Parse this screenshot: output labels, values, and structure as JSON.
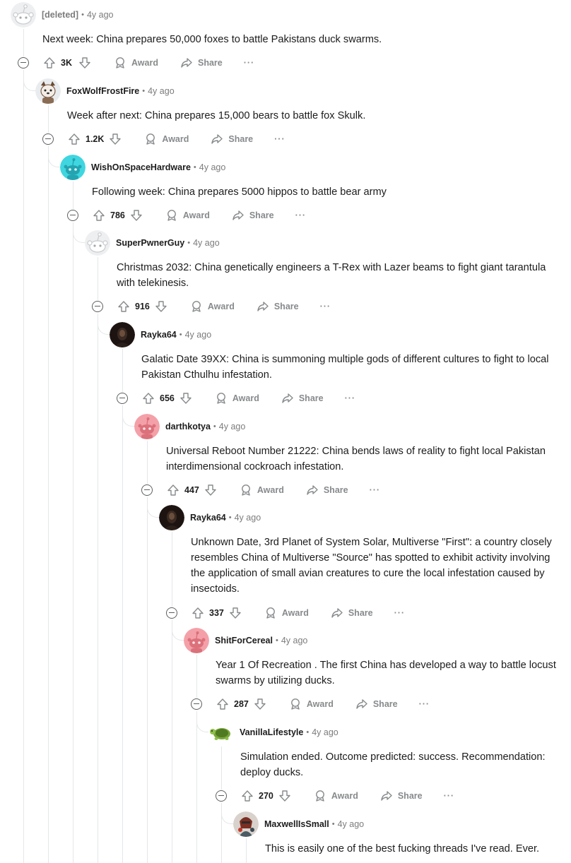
{
  "comments": [
    {
      "user": "[deleted]",
      "time": "4y ago",
      "lines": [
        "Next week: China prepares 50,000 foxes to battle Pakistans duck swarms."
      ],
      "votes": "3K",
      "avatar": "snoo-gray"
    },
    {
      "user": "FoxWolfFrostFire",
      "time": "4y ago",
      "lines": [
        "Week after next: China prepares 15,000 bears to battle fox Skulk."
      ],
      "votes": "1.2K",
      "avatar": "fox"
    },
    {
      "user": "WishOnSpaceHardware",
      "time": "4y ago",
      "lines": [
        "Following week: China prepares 5000 hippos to battle bear army"
      ],
      "votes": "786",
      "avatar": "snoo-teal"
    },
    {
      "user": "SuperPwnerGuy",
      "time": "4y ago",
      "lines": [
        "Christmas 2032: China genetically engineers a T-Rex with Lazer beams to fight giant tarantula",
        "with telekinesis."
      ],
      "votes": "916",
      "avatar": "snoo-gray"
    },
    {
      "user": "Rayka64",
      "time": "4y ago",
      "lines": [
        "Galatic Date 39XX: China is summoning multiple gods of different cultures to fight to local",
        "Pakistan Cthulhu infestation."
      ],
      "votes": "656",
      "avatar": "dark"
    },
    {
      "user": "darthkotya",
      "time": "4y ago",
      "lines": [
        "Universal Reboot Number 21222: China bends laws of reality to fight local Pakistan",
        "interdimensional cockroach infestation."
      ],
      "votes": "447",
      "avatar": "snoo-pink"
    },
    {
      "user": "Rayka64",
      "time": "4y ago",
      "lines": [
        "Unknown Date, 3rd Planet of System Solar, Multiverse \"First\": a country closely",
        "resembles China of Multiverse \"Source\" has spotted to exhibit activity involving",
        "the application of small avian creatures to cure the local infestation caused by",
        "insectoids."
      ],
      "votes": "337",
      "avatar": "dark"
    },
    {
      "user": "ShitForCereal",
      "time": "4y ago",
      "lines": [
        "Year 1 Of Recreation . The first China has developed a way to battle locust",
        "swarms by utilizing ducks."
      ],
      "votes": "287",
      "avatar": "snoo-pink"
    },
    {
      "user": "VanillaLifestyle",
      "time": "4y ago",
      "lines": [
        "Simulation ended. Outcome predicted: success. Recommendation:",
        "deploy ducks."
      ],
      "votes": "270",
      "avatar": "turtle"
    },
    {
      "user": "MaxwellIsSmall",
      "time": "4y ago",
      "lines": [
        "This is easily one of the best fucking threads I've read. Ever."
      ],
      "votes": "",
      "avatar": "knight"
    }
  ],
  "labels": {
    "award": "Award",
    "share": "Share",
    "more": "···",
    "sep": "•"
  },
  "colors": {
    "line": "#e3e6e8",
    "muted": "#878a8c",
    "text": "#1c1c1c",
    "teal": "#3fd6e0",
    "pink": "#f28b96"
  }
}
